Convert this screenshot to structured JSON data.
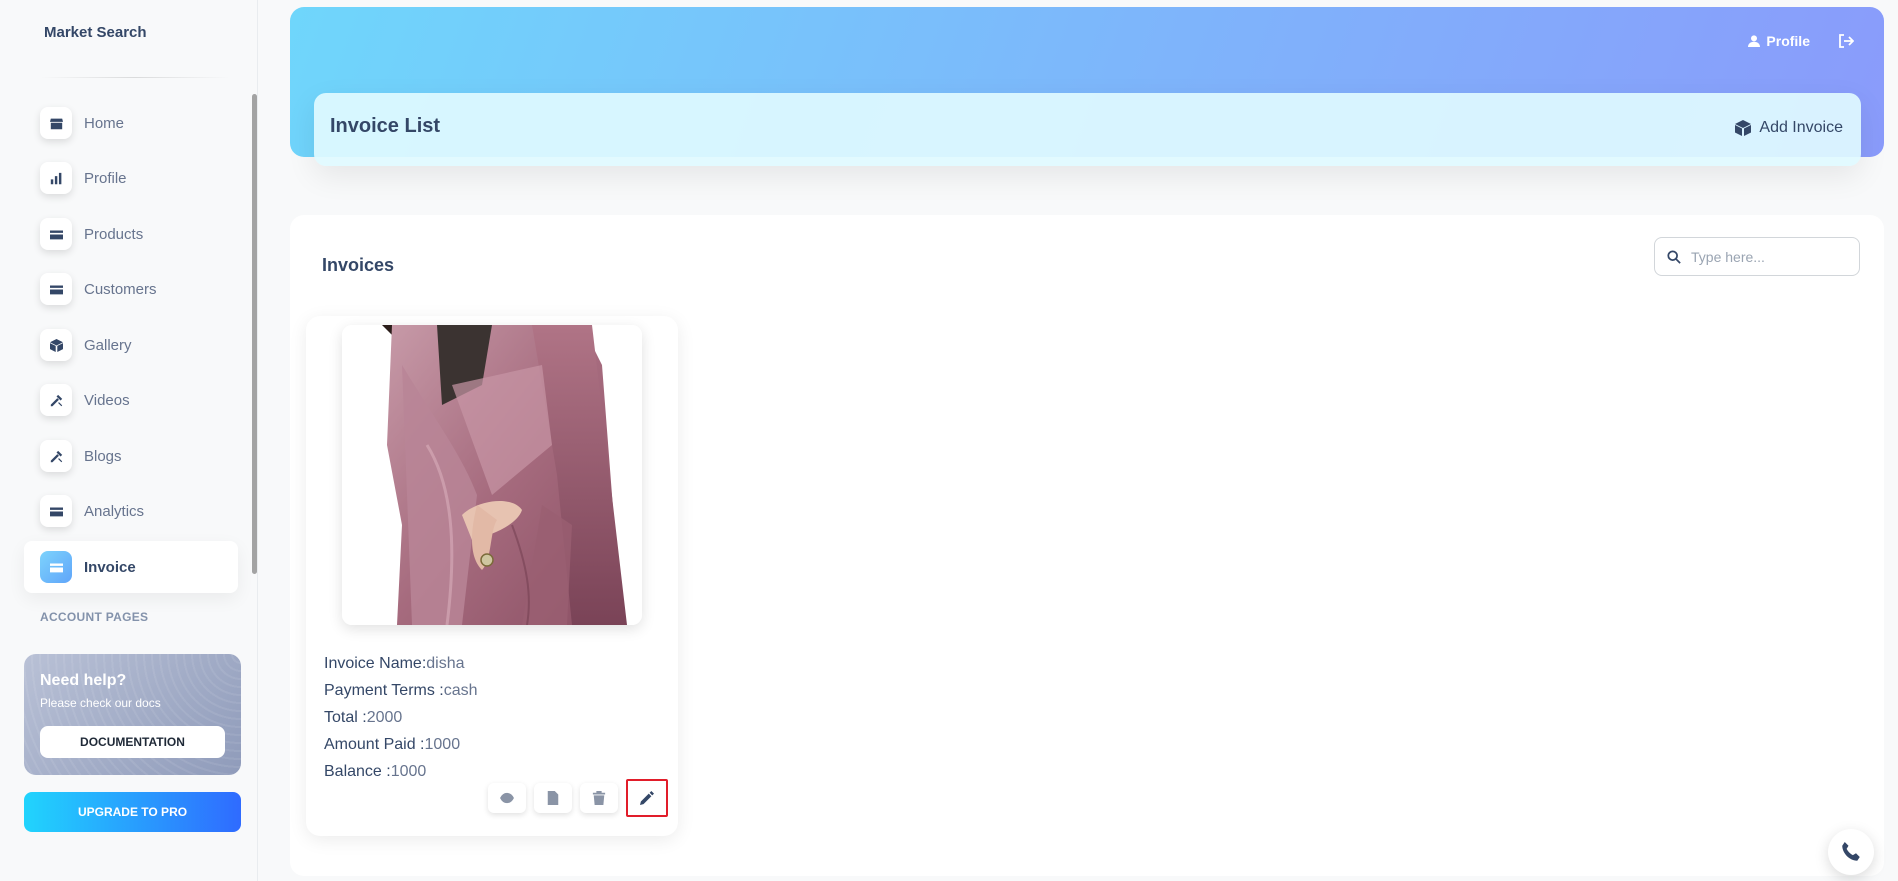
{
  "sidebar": {
    "brand": "Market Search",
    "items": [
      {
        "label": "Home",
        "icon": "store-icon"
      },
      {
        "label": "Profile",
        "icon": "chart-bar-icon"
      },
      {
        "label": "Products",
        "icon": "credit-card-icon"
      },
      {
        "label": "Customers",
        "icon": "credit-card-icon"
      },
      {
        "label": "Gallery",
        "icon": "box-icon"
      },
      {
        "label": "Videos",
        "icon": "tools-icon"
      },
      {
        "label": "Blogs",
        "icon": "tools-icon"
      },
      {
        "label": "Analytics",
        "icon": "credit-card-icon"
      },
      {
        "label": "Invoice",
        "icon": "credit-card-icon",
        "active": true
      }
    ],
    "section_title": "ACCOUNT PAGES",
    "help": {
      "title": "Need help?",
      "subtitle": "Please check our docs",
      "button": "DOCUMENTATION"
    },
    "upgrade": "UPGRADE TO PRO"
  },
  "header": {
    "profile": "Profile",
    "page_title": "Invoice List",
    "add_invoice": "Add Invoice"
  },
  "main": {
    "title": "Invoices",
    "search": {
      "placeholder": "Type here..."
    },
    "invoice": {
      "name_label": "Invoice Name:",
      "name": "disha",
      "terms_label": "Payment Terms :",
      "terms": "cash",
      "total_label": "Total :",
      "total": "2000",
      "paid_label": "Amount Paid :",
      "paid": "1000",
      "balance_label": "Balance :",
      "balance": "1000"
    }
  },
  "colors": {
    "accent": "#344767",
    "header_start": "#6fd6fb",
    "header_end": "#8a9bfb",
    "highlight_border": "#e11d2a",
    "upgrade_start": "#21d4fd",
    "upgrade_end": "#2f6bff"
  }
}
